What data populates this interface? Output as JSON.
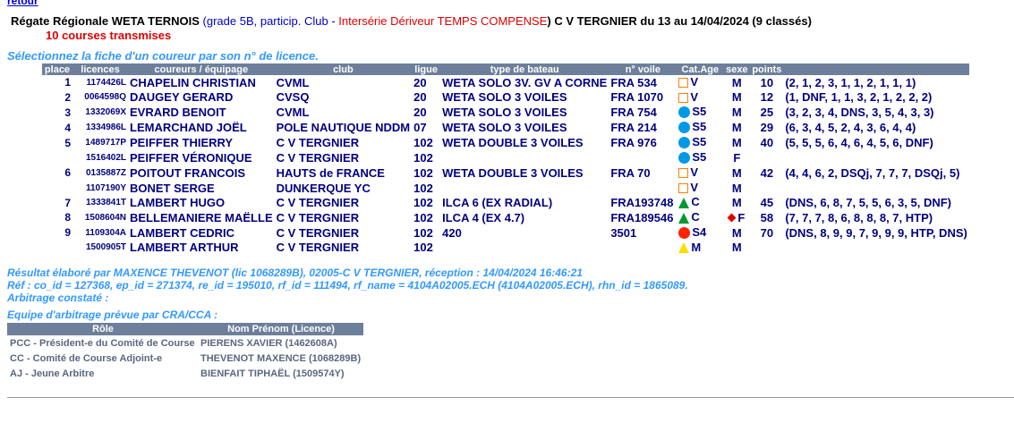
{
  "nav": {
    "retour": "retour"
  },
  "header": {
    "event": "Régate Régionale WETA TERNOIS",
    "grade": " (grade 5B, particip. Club - ",
    "inter": "Intersérie Dériveur TEMPS COMPENSE",
    "rest": ") C V TERGNIER du 13 au 14/04/2024 (9 classés)",
    "subtitle": "10 courses transmises",
    "hint": "Sélectionnez la fiche d'un coureur par son n° de licence."
  },
  "results": {
    "columns": [
      "place",
      "licences",
      "coureurs / équipage",
      "club",
      "ligue",
      "type de bateau",
      "n° voile",
      "Cat.Age",
      "sexe",
      "points",
      ""
    ],
    "rows": [
      {
        "place": "1",
        "lic": "1174426L",
        "name": "CHAPELIN CHRISTIAN",
        "club": "CVML",
        "ligue": "20",
        "boat": "WETA SOLO 3V. GV A CORNE",
        "sail": "FRA 534",
        "sym": "sq",
        "age": "V",
        "diamond": false,
        "sex": "M",
        "pts": "10",
        "detail": "(2, 1, 2, 3, 1, 1, 2, 1, 1, 1)"
      },
      {
        "place": "2",
        "lic": "0064598Q",
        "name": "DAUGEY GERARD",
        "club": "CVSQ",
        "ligue": "20",
        "boat": "WETA SOLO 3 VOILES",
        "sail": "FRA 1070",
        "sym": "sq",
        "age": "V",
        "diamond": false,
        "sex": "M",
        "pts": "12",
        "detail": "(1, DNF, 1, 1, 3, 2, 1, 2, 2, 2)"
      },
      {
        "place": "3",
        "lic": "1332069X",
        "name": "EVRARD BENOIT",
        "club": "CVML",
        "ligue": "20",
        "boat": "WETA SOLO 3 VOILES",
        "sail": "FRA 754",
        "sym": "dot-blue",
        "age": "S5",
        "diamond": false,
        "sex": "M",
        "pts": "25",
        "detail": "(3, 2, 3, 4, DNS, 3, 5, 4, 3, 3)"
      },
      {
        "place": "4",
        "lic": "1334986L",
        "name": "LEMARCHAND JOËL",
        "club": "POLE NAUTIQUE NDDM",
        "ligue": "07",
        "boat": "WETA SOLO 3 VOILES",
        "sail": "FRA 214",
        "sym": "dot-blue",
        "age": "S5",
        "diamond": false,
        "sex": "M",
        "pts": "29",
        "detail": "(6, 3, 4, 5, 2, 4, 3, 6, 4, 4)"
      },
      {
        "place": "5",
        "lic": "1489717P",
        "name": "PEIFFER THIERRY",
        "club": "C V TERGNIER",
        "ligue": "102",
        "boat": "WETA DOUBLE 3 VOILES",
        "sail": "FRA 976",
        "sym": "dot-blue",
        "age": "S5",
        "diamond": false,
        "sex": "M",
        "pts": "40",
        "detail": "(5, 5, 5, 6, 4, 6, 4, 5, 6, DNF)"
      },
      {
        "place": "",
        "lic": "1516402L",
        "name": "PEIFFER VÉRONIQUE",
        "club": "C V TERGNIER",
        "ligue": "102",
        "boat": "",
        "sail": "",
        "sym": "dot-blue",
        "age": "S5",
        "diamond": false,
        "sex": "F",
        "pts": "",
        "detail": ""
      },
      {
        "place": "6",
        "lic": "0135887Z",
        "name": "POITOUT FRANCOIS",
        "club": "HAUTS de FRANCE",
        "ligue": "102",
        "boat": "WETA DOUBLE 3 VOILES",
        "sail": "FRA 70",
        "sym": "sq",
        "age": "V",
        "diamond": false,
        "sex": "M",
        "pts": "42",
        "detail": "(4, 4, 6, 2, DSQj, 7, 7, 7, DSQj, 5)"
      },
      {
        "place": "",
        "lic": "1107190Y",
        "name": "BONET SERGE",
        "club": "DUNKERQUE YC",
        "ligue": "102",
        "boat": "",
        "sail": "",
        "sym": "sq",
        "age": "V",
        "diamond": false,
        "sex": "M",
        "pts": "",
        "detail": ""
      },
      {
        "place": "7",
        "lic": "1333841T",
        "name": "LAMBERT HUGO",
        "club": "C V TERGNIER",
        "ligue": "102",
        "boat": "ILCA 6 (EX RADIAL)",
        "sail": "FRA193748",
        "sym": "tri-green",
        "age": "C",
        "diamond": false,
        "sex": "M",
        "pts": "45",
        "detail": "(DNS, 6, 8, 7, 5, 5, 6, 3, 5, DNF)"
      },
      {
        "place": "8",
        "lic": "1508604N",
        "name": "BELLEMANIERE MAËLLE",
        "club": "C V TERGNIER",
        "ligue": "102",
        "boat": "ILCA 4 (EX 4.7)",
        "sail": "FRA189546",
        "sym": "tri-green",
        "age": "C",
        "diamond": true,
        "sex": "F",
        "pts": "58",
        "detail": "(7, 7, 7, 8, 6, 8, 8, 8, 7, HTP)"
      },
      {
        "place": "9",
        "lic": "1109304A",
        "name": "LAMBERT CEDRIC",
        "club": "C V TERGNIER",
        "ligue": "102",
        "boat": "420",
        "sail": "3501",
        "sym": "dot-red",
        "age": "S4",
        "diamond": false,
        "sex": "M",
        "pts": "70",
        "detail": "(DNS, 8, 9, 9, 7, 9, 9, 9, HTP, DNS)"
      },
      {
        "place": "",
        "lic": "1500905T",
        "name": "LAMBERT ARTHUR",
        "club": "C V TERGNIER",
        "ligue": "102",
        "boat": "",
        "sail": "",
        "sym": "tri-yellow",
        "age": "M",
        "diamond": false,
        "sex": "M",
        "pts": "",
        "detail": ""
      }
    ]
  },
  "footer": {
    "result": "Résultat élaboré par MAXENCE THEVENOT (lic 1068289B), 02005-C V TERGNIER, réception : 14/04/2024 16:46:21",
    "ref": "Réf : co_id = 127368, ep_id = 271374, re_id = 195010, rf_id = 111494, rf_name = 4104A02005.ECH (4104A02005.ECH), rhn_id = 1865089.",
    "arbitrage": "Arbitrage constaté :",
    "equipe": "Equipe d'arbitrage prévue par CRA/CCA :"
  },
  "officials": {
    "columns": [
      "Rôle",
      "Nom Prénom (Licence)"
    ],
    "rows": [
      {
        "role": "PCC - Président-e du Comité de Course",
        "name": "PIERENS XAVIER (1462608A)"
      },
      {
        "role": "CC - Comité de Course Adjoint-e",
        "name": "THEVENOT MAXENCE (1068289B)"
      },
      {
        "role": "AJ - Jeune Arbitre",
        "name": "BIENFAIT TIPHAËL (1509574Y)"
      }
    ]
  },
  "colors": {
    "text": "#000080",
    "header_bg": "#6d7f9a",
    "accent_red": "#e00000",
    "hint_blue": "#3399ff",
    "veteran_square": "#ff8000",
    "senior_dot": "#0099e5",
    "cadet_triangle": "#009933",
    "minime_triangle": "#ffdd00",
    "s4_dot": "#ff2200"
  }
}
